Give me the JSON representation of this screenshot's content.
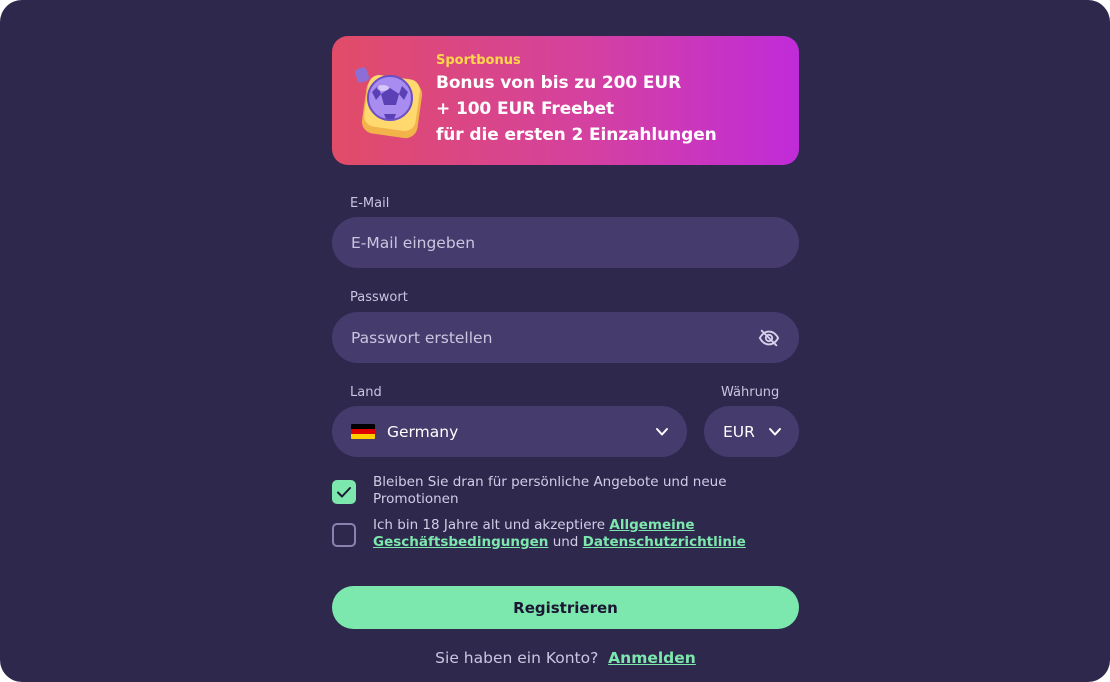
{
  "banner": {
    "tag": "Sportbonus",
    "line1": "Bonus von bis zu 200 EUR",
    "line2": "+ 100 EUR Freebet",
    "line3": "für die ersten 2 Einzahlungen"
  },
  "email": {
    "label": "E-Mail",
    "placeholder": "E-Mail eingeben"
  },
  "password": {
    "label": "Passwort",
    "placeholder": "Passwort erstellen",
    "toggle_icon": "eye-off-icon"
  },
  "country": {
    "label": "Land",
    "value": "Germany",
    "flag": "germany-flag-icon"
  },
  "currency": {
    "label": "Währung",
    "value": "EUR"
  },
  "consent": {
    "promo_text": "Bleiben Sie dran für persönliche Angebote und neue Promotionen",
    "promo_checked": true,
    "terms_prefix": "Ich bin 18 Jahre alt und akzeptiere ",
    "terms_link": "Allgemeine Geschäftsbedingungen",
    "terms_and": " und ",
    "privacy_link": "Datenschutzrichtlinie",
    "terms_checked": false
  },
  "register_button": "Registrieren",
  "footer": {
    "question": "Sie haben ein Konto?",
    "login_link": "Anmelden"
  },
  "colors": {
    "background": "#2e284d",
    "input": "#463b6d",
    "accent": "#7de8ad",
    "banner_start": "#e14c67",
    "banner_end": "#c02bd9"
  }
}
